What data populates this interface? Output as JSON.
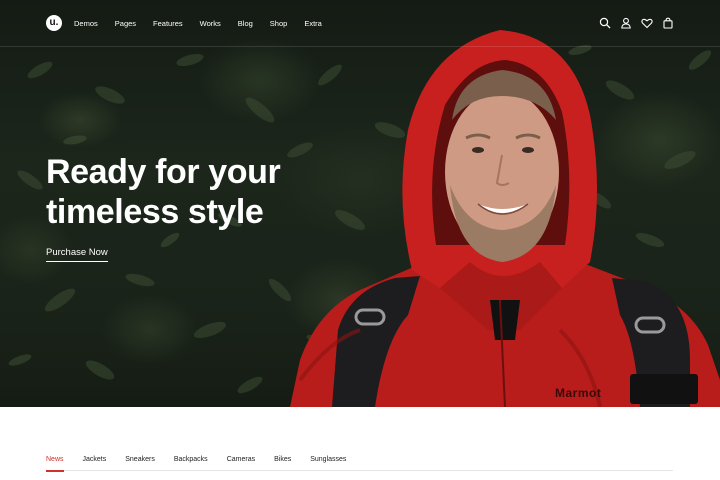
{
  "brand": {
    "logo_letter": "u."
  },
  "nav": {
    "items": [
      "Demos",
      "Pages",
      "Features",
      "Works",
      "Blog",
      "Shop",
      "Extra"
    ]
  },
  "header_icons": [
    "search-icon",
    "user-icon",
    "heart-icon",
    "shopping-bag-icon"
  ],
  "hero": {
    "title_line1": "Ready for your",
    "title_line2": "timeless style",
    "cta_label": "Purchase Now",
    "jacket_brand": "Marmot"
  },
  "tabs": {
    "items": [
      "News",
      "Jackets",
      "Sneakers",
      "Backpacks",
      "Cameras",
      "Bikes",
      "Sunglasses"
    ],
    "active": "News"
  },
  "colors": {
    "accent": "#d0312d",
    "hero_bg": "#1a2319",
    "jacket_red": "#c8201e",
    "text_light": "#ffffff"
  }
}
